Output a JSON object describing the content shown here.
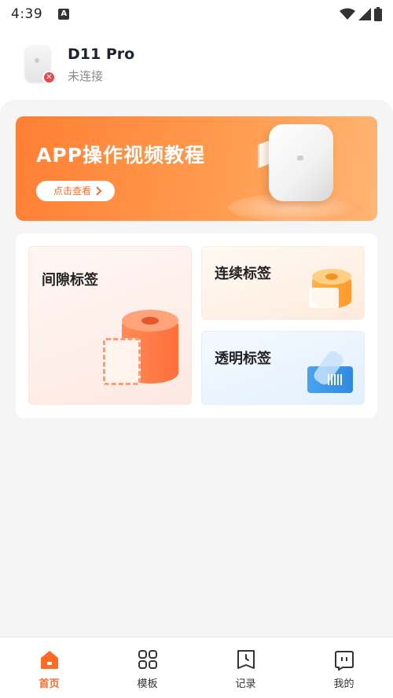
{
  "status_bar": {
    "time": "4:39",
    "indicator": "A"
  },
  "device": {
    "name": "D11 Pro",
    "status": "未连接"
  },
  "banner": {
    "title": "APP操作视频教程",
    "button_label": "点击查看"
  },
  "label_types": {
    "gap": "间隙标签",
    "continuous": "连续标签",
    "transparent": "透明标签"
  },
  "bottom_nav": {
    "items": [
      {
        "label": "首页",
        "icon": "home-icon",
        "active": true
      },
      {
        "label": "模板",
        "icon": "grid-icon",
        "active": false
      },
      {
        "label": "记录",
        "icon": "record-icon",
        "active": false
      },
      {
        "label": "我的",
        "icon": "profile-icon",
        "active": false
      }
    ]
  },
  "colors": {
    "accent": "#ff6a25",
    "banner_start": "#ff7f35",
    "banner_end": "#ffb574",
    "disconnect": "#e8474b"
  }
}
